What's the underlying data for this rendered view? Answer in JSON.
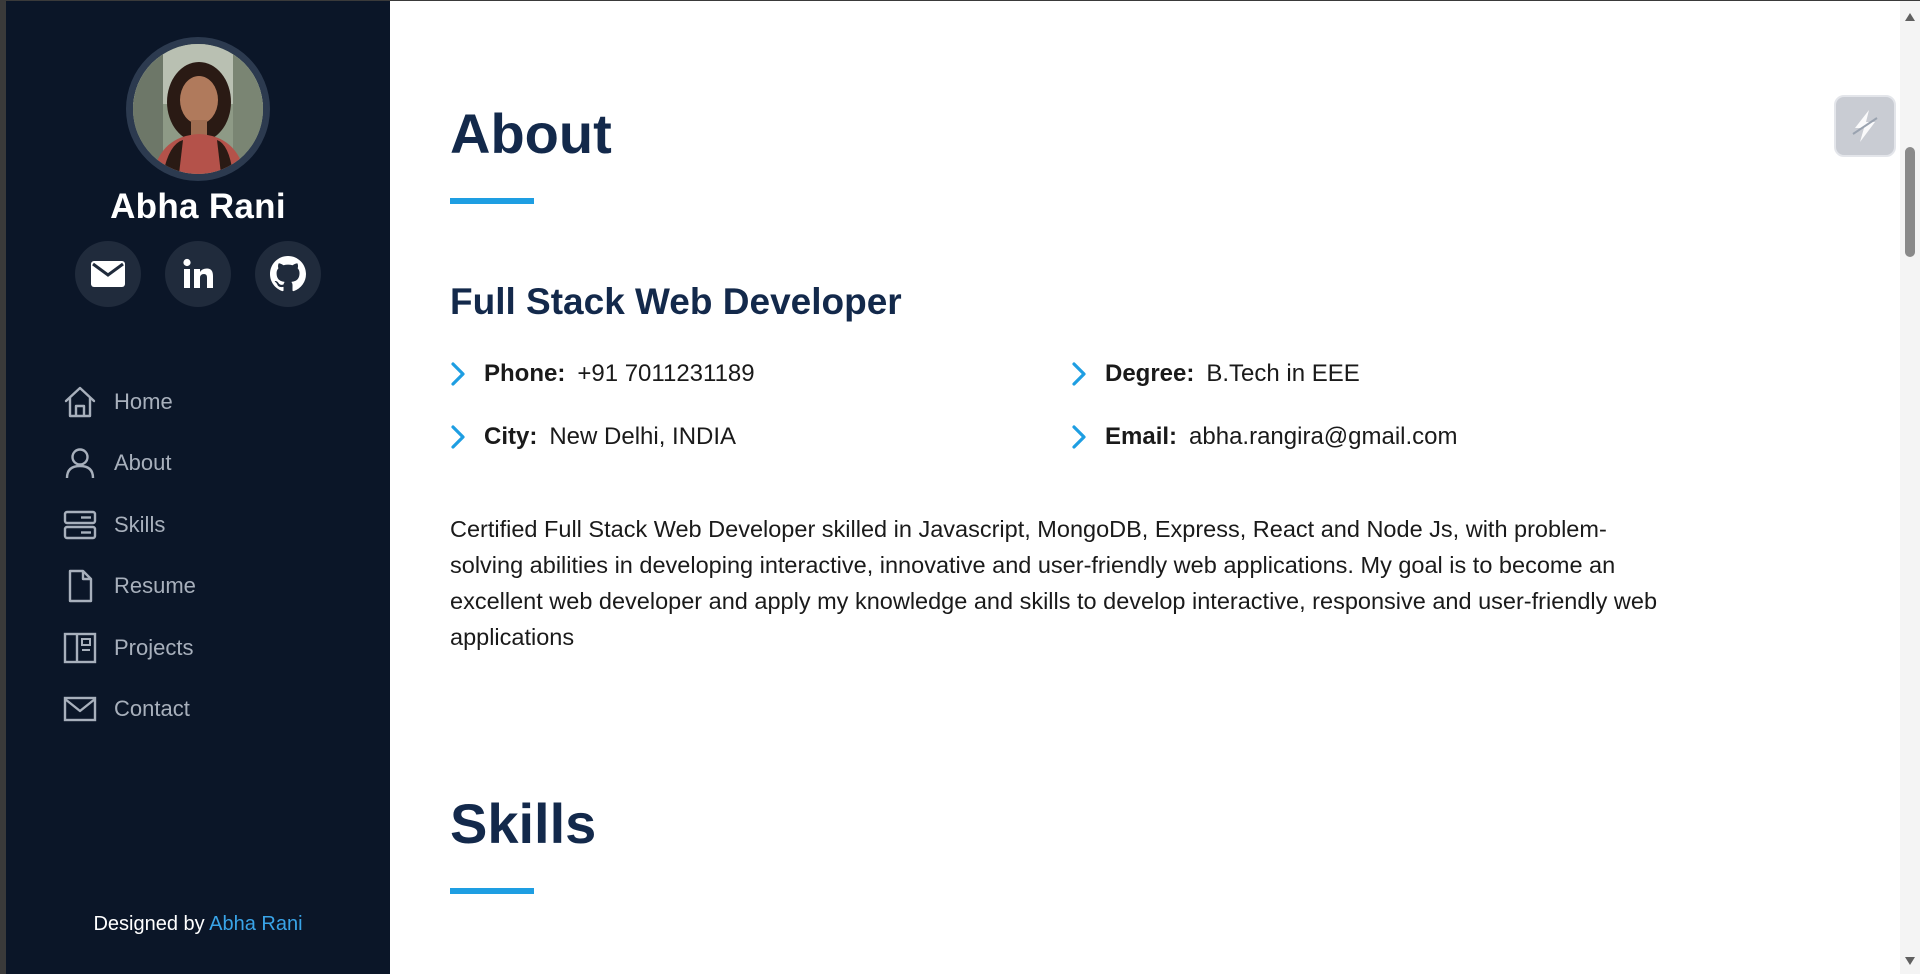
{
  "profile": {
    "name": "Abha Rani",
    "avatar_alt": "Abha Rani profile photo"
  },
  "social": [
    {
      "icon": "envelope-icon",
      "name": "email-link"
    },
    {
      "icon": "linkedin-icon",
      "name": "linkedin-link"
    },
    {
      "icon": "github-icon",
      "name": "github-link"
    }
  ],
  "nav": {
    "home": "Home",
    "about": "About",
    "skills": "Skills",
    "resume": "Resume",
    "projects": "Projects",
    "contact": "Contact"
  },
  "footer": {
    "prefix": "Designed by",
    "link": "Abha Rani"
  },
  "about": {
    "title": "About",
    "role": "Full Stack Web Developer",
    "info": {
      "phone_label": "Phone:",
      "phone": "+91 7011231189",
      "degree_label": "Degree:",
      "degree": "B.Tech in EEE",
      "city_label": "City:",
      "city": "New Delhi, INDIA",
      "email_label": "Email:",
      "email": "abha.rangira@gmail.com"
    },
    "bio": "Certified Full Stack Web Developer skilled in Javascript, MongoDB, Express, React and Node Js, with problem-solving abilities in developing interactive, innovative and user-friendly web applications. My goal is to become an excellent web developer and apply my knowledge and skills to develop interactive, responsive and user-friendly web applications"
  },
  "skills": {
    "title": "Skills"
  },
  "colors": {
    "sidebar_bg": "#0b1628",
    "accent": "#1e9ee2",
    "heading": "#13294b",
    "nav_text": "#a8b0bc",
    "link": "#39a4e8"
  }
}
